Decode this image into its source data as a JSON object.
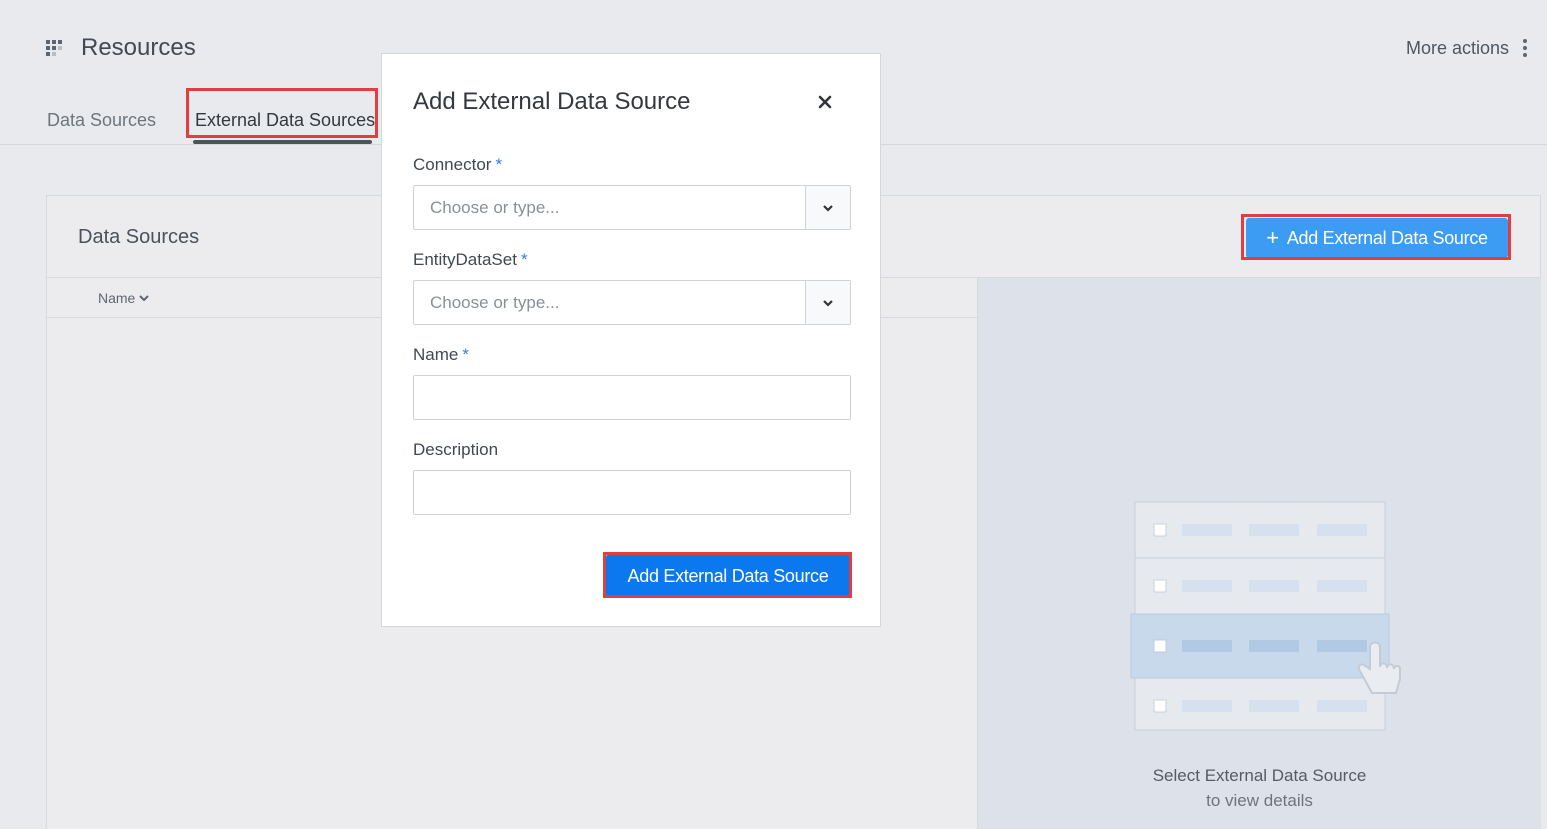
{
  "header": {
    "title": "Resources",
    "more_actions_label": "More actions"
  },
  "tabs": [
    {
      "label": "Data Sources",
      "active": false
    },
    {
      "label": "External Data Sources",
      "active": true
    }
  ],
  "panel": {
    "title": "Data Sources",
    "add_button_label": "Add External Data Source",
    "columns": [
      {
        "label": "Name",
        "sort": "descending"
      }
    ],
    "empty_state": {
      "title": "Select External Data Source",
      "subtitle": "to view details"
    }
  },
  "modal": {
    "title": "Add External Data Source",
    "fields": {
      "connector": {
        "label": "Connector",
        "required": true,
        "placeholder": "Choose or type...",
        "value": ""
      },
      "entity_data_set": {
        "label": "EntityDataSet",
        "required": true,
        "placeholder": "Choose or type...",
        "value": ""
      },
      "name": {
        "label": "Name",
        "required": true,
        "value": ""
      },
      "description": {
        "label": "Description",
        "required": false,
        "value": ""
      }
    },
    "submit_label": "Add External Data Source",
    "required_marker": "*"
  },
  "colors": {
    "primary_button": "#0b78f0",
    "secondary_button": "#3c9cf4",
    "highlight": "#e23e40",
    "required": "#2f7be0"
  },
  "icons": [
    "grid-icon",
    "kebab-icon",
    "plus-icon",
    "chevron-down-icon",
    "close-icon",
    "pointer-hand-icon"
  ]
}
